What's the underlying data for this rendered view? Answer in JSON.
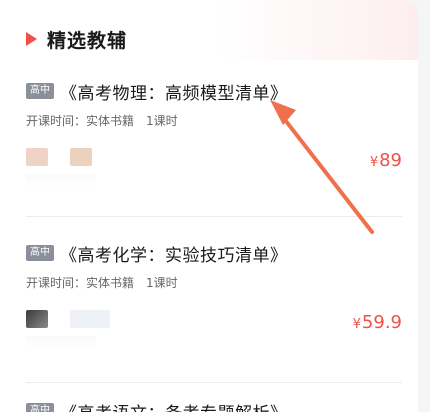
{
  "section": {
    "title": "精选教辅"
  },
  "courses": [
    {
      "badge": "高中",
      "title": "《高考物理：高频模型清单》",
      "meta_type": "开课时间：实体书籍",
      "meta_count": "1课时",
      "price_symbol": "¥",
      "price_value": "89"
    },
    {
      "badge": "高中",
      "title": "《高考化学：实验技巧清单》",
      "meta_type": "开课时间：实体书籍",
      "meta_count": "1课时",
      "price_symbol": "¥",
      "price_value": "59.9"
    },
    {
      "badge": "高中",
      "title": "《高考语文：备考专题解析》"
    }
  ],
  "annotation": {
    "color": "#f0704e"
  },
  "colors": {
    "accent": "#f0504a",
    "badge_bg": "#8a8f99"
  }
}
